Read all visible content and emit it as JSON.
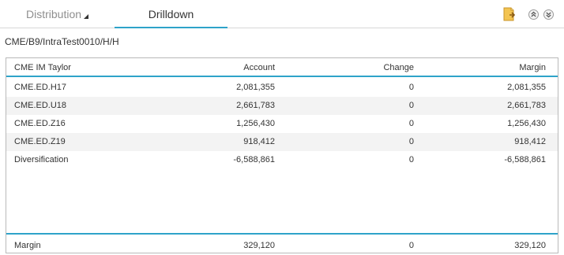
{
  "tabs": {
    "distribution_label": "Distribution",
    "drilldown_label": "Drilldown"
  },
  "toolbar": {
    "icons": [
      "export-icon",
      "expand-all-icon",
      "collapse-all-icon"
    ],
    "accent_color": "#2ea3c9"
  },
  "breadcrumb": "CME/B9/IntraTest0010/H/H",
  "table": {
    "columns": [
      "CME IM Taylor",
      "Account",
      "Change",
      "Margin"
    ],
    "rows": [
      {
        "name": "CME.ED.H17",
        "account": "2,081,355",
        "change": "0",
        "margin": "2,081,355"
      },
      {
        "name": "CME.ED.U18",
        "account": "2,661,783",
        "change": "0",
        "margin": "2,661,783"
      },
      {
        "name": "CME.ED.Z16",
        "account": "1,256,430",
        "change": "0",
        "margin": "1,256,430"
      },
      {
        "name": "CME.ED.Z19",
        "account": "918,412",
        "change": "0",
        "margin": "918,412"
      },
      {
        "name": "Diversification",
        "account": "-6,588,861",
        "change": "0",
        "margin": "-6,588,861"
      }
    ],
    "footer": {
      "name": "Margin",
      "account": "329,120",
      "change": "0",
      "margin": "329,120"
    }
  }
}
